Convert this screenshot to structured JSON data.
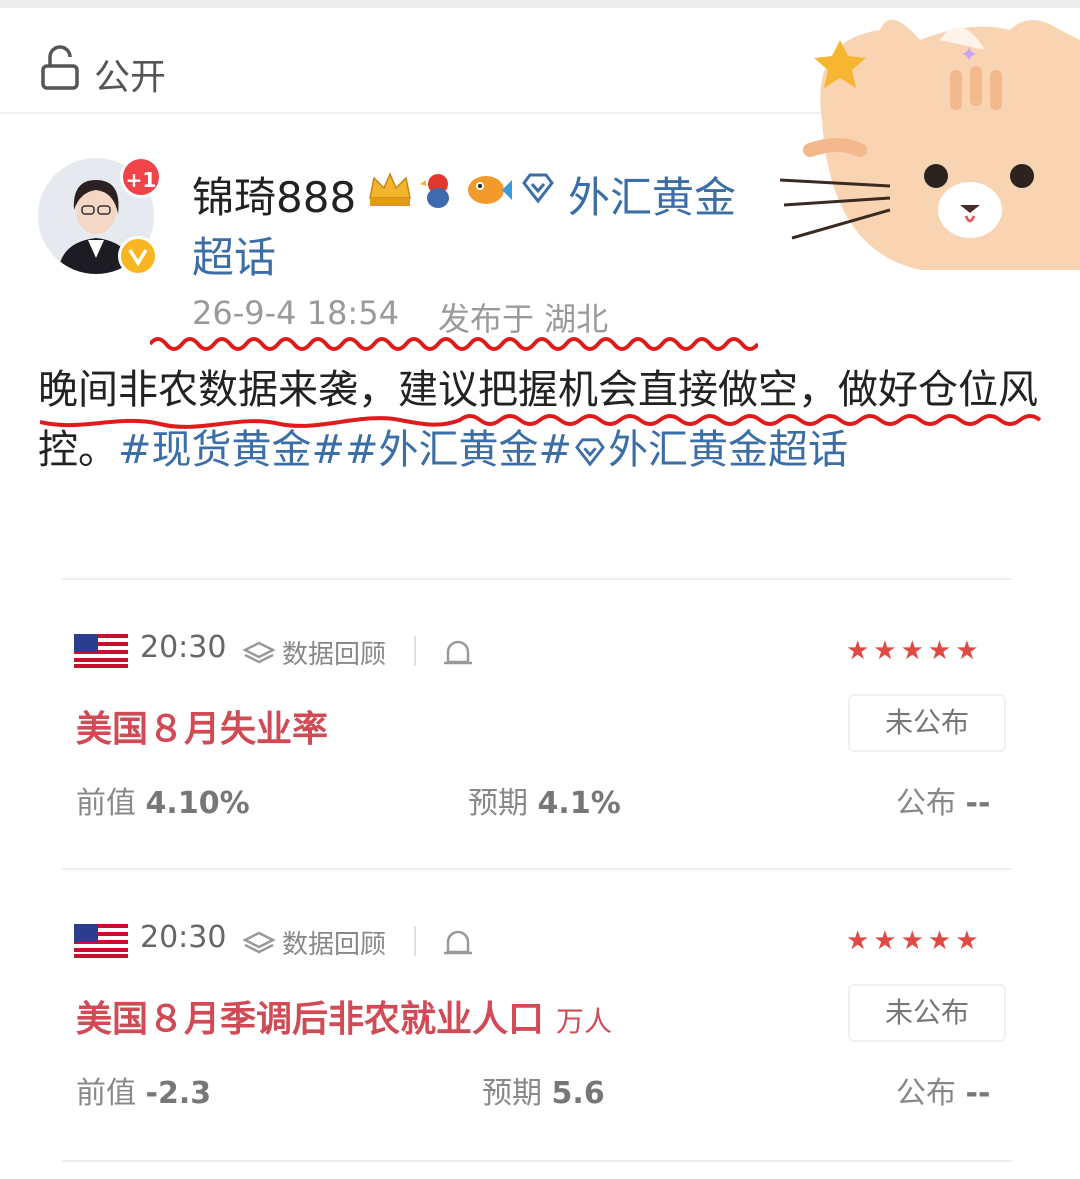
{
  "visibility": {
    "label": "公开",
    "icon": "lock-open-icon"
  },
  "author": {
    "name": "锦琦888",
    "notification_badge": "+1",
    "verified": true,
    "medals": [
      "crown-icon",
      "rooster-icon",
      "fish-icon"
    ]
  },
  "topic": {
    "line1": "外汇黄金",
    "line2": "超话",
    "icon": "diamond-icon"
  },
  "meta": {
    "date": "26-9-4 18:54",
    "location": "发布于 湖北"
  },
  "post": {
    "text": "晚间非农数据来袭，建议把握机会直接做空，做好仓位风控。",
    "tags": [
      "#现货黄金#",
      "#外汇黄金#",
      "外汇黄金超话"
    ]
  },
  "events": [
    {
      "flag": "us-flag-icon",
      "time": "20:30",
      "review_label": "数据回顾",
      "stars": 5,
      "stars_text": "★★★★★",
      "title": "美国８月失业率",
      "unit": "",
      "status": "未公布",
      "previous_label": "前值",
      "previous": "4.10%",
      "expected_label": "预期",
      "expected": "4.1%",
      "published_label": "公布",
      "published": "--"
    },
    {
      "flag": "us-flag-icon",
      "time": "20:30",
      "review_label": "数据回顾",
      "stars": 5,
      "stars_text": "★★★★★",
      "title": "美国８月季调后非农就业人口",
      "unit": "万人",
      "status": "未公布",
      "previous_label": "前值",
      "previous": "-2.3",
      "expected_label": "预期",
      "expected": "5.6",
      "published_label": "公布",
      "published": "--"
    }
  ],
  "colors": {
    "accent_red": "#d04b55",
    "link_blue": "#3b6ea6",
    "star_red": "#e14a44",
    "annotation_red": "#e01b1b"
  }
}
